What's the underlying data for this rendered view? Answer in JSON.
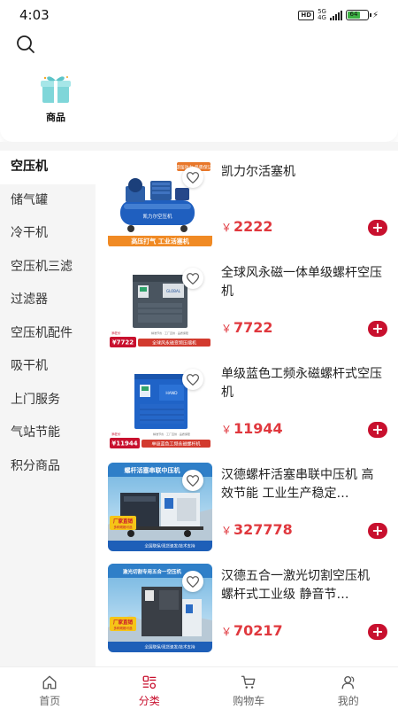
{
  "status_bar": {
    "time": "4:03",
    "hd": "HD",
    "net_top": "5G",
    "net_bottom": "4G",
    "battery": "64"
  },
  "header": {
    "search_icon": "search-icon"
  },
  "featured": {
    "items": [
      {
        "label": "商品",
        "icon": "gift-box-icon"
      }
    ]
  },
  "sidebar": {
    "items": [
      {
        "label": "空压机",
        "active": true
      },
      {
        "label": "储气罐"
      },
      {
        "label": "冷干机"
      },
      {
        "label": "空压机三滤"
      },
      {
        "label": "过滤器"
      },
      {
        "label": "空压机配件"
      },
      {
        "label": "吸干机"
      },
      {
        "label": "上门服务"
      },
      {
        "label": "气站节能"
      },
      {
        "label": "积分商品"
      }
    ]
  },
  "products": [
    {
      "title": "凯力尔活塞机",
      "currency": "￥",
      "price": "2222",
      "image": {
        "type": "piston",
        "tag": "高压打气 工业活塞机",
        "top_badge": "超强动力 品质保证",
        "brand": "凯力尔空压机"
      }
    },
    {
      "title": "全球风永磁一体单级螺杆空压机",
      "currency": "￥",
      "price": "7722",
      "image": {
        "type": "screw-gray",
        "price_tag": "¥7722",
        "price_note": "添狂价",
        "banner": "全球风永磁变频压缩机",
        "feats": "精准节省 · 工厂直供 · 品质保障"
      }
    },
    {
      "title": "单级蓝色工频永磁螺杆式空压机",
      "currency": "￥",
      "price": "11944",
      "image": {
        "type": "screw-blue",
        "price_tag": "¥11944",
        "price_note": "添狂价",
        "banner": "单级蓝色工频永磁螺杆机",
        "feats": "精准节省 · 工厂直供 · 品质保障"
      }
    },
    {
      "title": "汉德螺杆活塞串联中压机 高效节能 工业生产稳定…",
      "currency": "￥",
      "price": "327778",
      "image": {
        "type": "trailer",
        "headline": "螺杆活塞串联中压机",
        "badge": "厂家直销",
        "badge_sub": "多种规格可选",
        "footer": "全国联保/现货速发/技术支持"
      }
    },
    {
      "title": "汉德五合一激光切割空压机 螺杆式工业级 静音节…",
      "currency": "￥",
      "price": "70217",
      "image": {
        "type": "laser",
        "headline": "激光切割专用五合一空压机",
        "badge": "厂家直销",
        "badge_sub": "多种规格可选",
        "footer": "全国联保/现货速发/技术支持"
      }
    }
  ],
  "bottom_nav": [
    {
      "label": "首页",
      "icon": "home-icon"
    },
    {
      "label": "分类",
      "icon": "category-icon",
      "active": true
    },
    {
      "label": "购物车",
      "icon": "cart-icon"
    },
    {
      "label": "我的",
      "icon": "profile-icon"
    }
  ],
  "colors": {
    "accent": "#c8102e",
    "price": "#e0383e",
    "sidebar_bg": "#f5f5f5"
  }
}
